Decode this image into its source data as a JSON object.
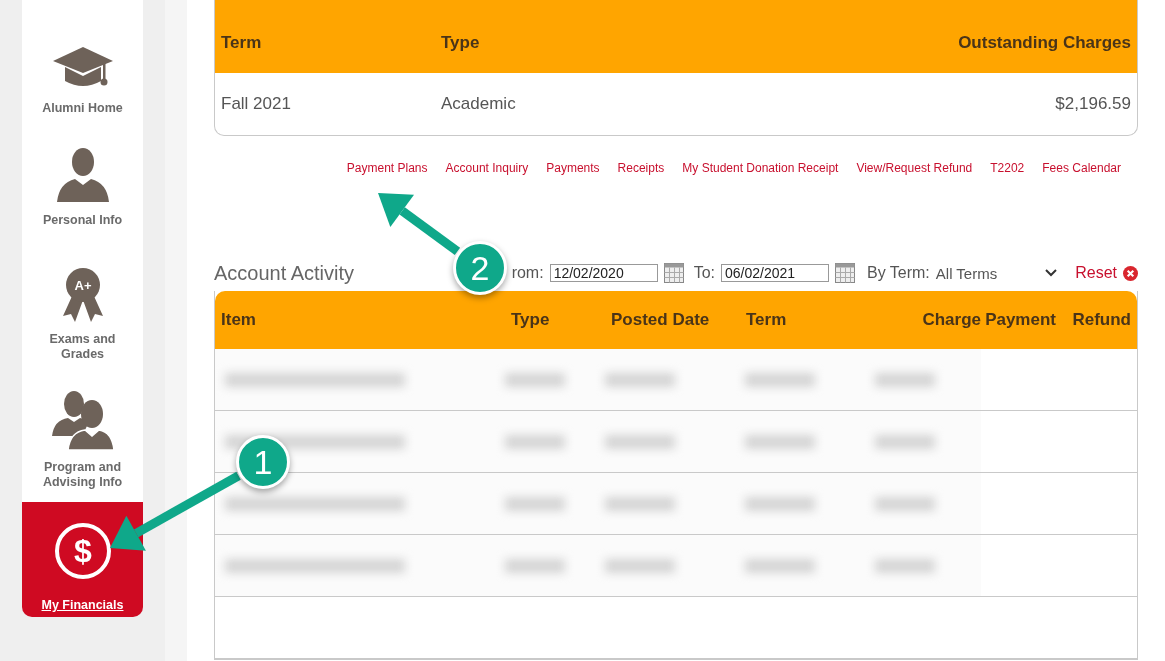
{
  "sidebar": {
    "items": [
      {
        "label": "Alumni Home",
        "kind": "cap",
        "selected": false
      },
      {
        "label": "Personal Info",
        "kind": "person",
        "selected": false
      },
      {
        "label": "Exams and Grades",
        "kind": "award",
        "glyph": "A+",
        "selected": false
      },
      {
        "label": "Program and Advising Info",
        "kind": "people",
        "selected": false
      },
      {
        "label": "My Financials",
        "kind": "dollar",
        "glyph": "$",
        "selected": true
      }
    ]
  },
  "charges_table": {
    "columns": [
      "Term",
      "Type",
      "Outstanding Charges"
    ],
    "rows": [
      [
        "Fall 2021",
        "Academic",
        "$2,196.59"
      ]
    ]
  },
  "links": [
    "Payment Plans",
    "Account Inquiry",
    "Payments",
    "Receipts",
    "My Student Donation Receipt",
    "View/Request Refund",
    "T2202",
    "Fees Calendar"
  ],
  "account_activity": {
    "title": "Account Activity",
    "from_label": "rom:",
    "from_value": "12/02/2020",
    "to_label": "To:",
    "to_value": "06/02/2021",
    "term_label": "By Term:",
    "term_value": "All Terms",
    "reset": "Reset",
    "columns": [
      "Item",
      "Type",
      "Posted Date",
      "Term",
      "Charge",
      "Payment",
      "Refund"
    ],
    "rows": [
      {
        "kind": "blurred"
      },
      {
        "kind": "blurred"
      },
      {
        "kind": "blurred"
      },
      {
        "kind": "blurred"
      },
      {
        "kind": "empty"
      }
    ]
  },
  "callouts": [
    {
      "number": "1"
    },
    {
      "number": "2"
    }
  ]
}
